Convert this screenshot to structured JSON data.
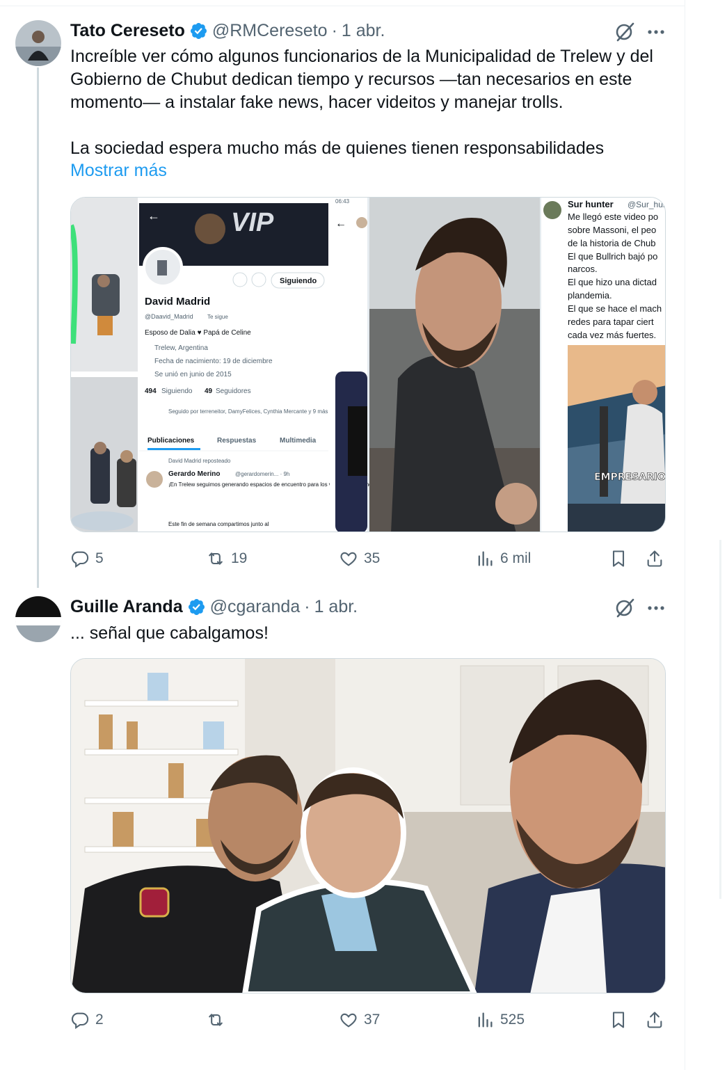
{
  "tweets": [
    {
      "author": "Tato Cereseto",
      "handle": "@RMCereseto",
      "separator": "·",
      "time": "1 abr.",
      "text_lines": [
        "Increíble ver cómo algunos funcionarios de la Municipalidad de Trelew y del",
        "Gobierno de Chubut dedican tiempo y recursos —tan necesarios en este",
        "momento— a instalar fake news, hacer videitos y manejar trolls.",
        "",
        "La sociedad espera mucho más de quienes tienen responsabilidades"
      ],
      "show_more": "Mostrar más",
      "replies": "5",
      "reposts": "19",
      "likes": "35",
      "views": "6 mil",
      "media": {
        "profile_card": {
          "status_time": "06:43",
          "banner_text": "VIP",
          "follow_button": "Siguiendo",
          "name": "David Madrid",
          "handle": "@Daavid_Madrid",
          "follows_you": "Te sigue",
          "bio": "Esposo de Dalia ♥ Papá de Celine",
          "location": "Trelew, Argentina",
          "birthday": "Fecha de nacimiento: 19 de diciembre",
          "joined": "Se unió en junio de 2015",
          "following_count": "494",
          "following_label": "Siguiendo",
          "followers_count": "49",
          "followers_label": "Seguidores",
          "followed_by": "Seguido por terreneitor, DamyFelices, Cynthia Mercante y 9 más",
          "tabs": [
            "Publicaciones",
            "Respuestas",
            "Multimedia"
          ],
          "repost_note": "David Madrid reposteado",
          "inner_author": "Gerardo Merino",
          "inner_handle": "@gerardomerin... · 9h",
          "inner_text": "¡En Trelew seguimos generando espacios de encuentro para los vecinos, y eso nos llena de orgullo!",
          "inner_text2": "Este fin de semana compartimos junto al"
        },
        "side_tweet": {
          "author": "Sur hunter",
          "handle": "@Sur_hun",
          "lines": [
            "Me llegó este video po",
            "sobre Massoni, el peo",
            "de la historia de Chub",
            "El que Bullrich bajó po",
            "narcos.",
            "El que hizo una dictad",
            "plandemia.",
            "El que se hace el mach",
            "redes para tapar ciert",
            "cada vez más fuertes."
          ],
          "video_caption": "EMPRESARIO"
        }
      }
    },
    {
      "author": "Guille Aranda",
      "handle": "@cgaranda",
      "separator": "·",
      "time": "1 abr.",
      "text_lines": [
        "... señal que cabalgamos!"
      ],
      "replies": "2",
      "reposts": "",
      "likes": "37",
      "views": "525"
    }
  ],
  "colors": {
    "text": "#0f1419",
    "secondary": "#536471",
    "link": "#1d9bf0",
    "verified": "#1d9bf0",
    "border": "#cfd9de"
  }
}
